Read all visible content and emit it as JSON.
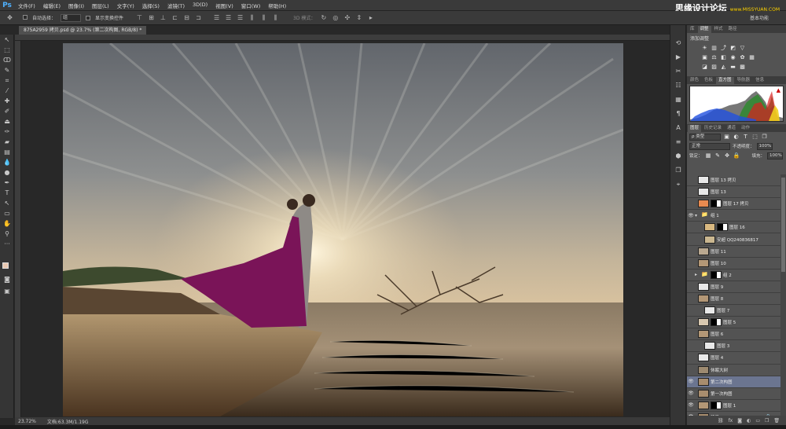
{
  "app": {
    "logo": "Ps"
  },
  "menu": [
    "文件(F)",
    "编辑(E)",
    "图像(I)",
    "图层(L)",
    "文字(Y)",
    "选择(S)",
    "滤镜(T)",
    "3D(D)",
    "视图(V)",
    "窗口(W)",
    "帮助(H)"
  ],
  "watermark": {
    "main": "思缘设计论坛",
    "sub": "www.MISSYUAN.COM"
  },
  "options": {
    "auto_select_label": "自动选择：",
    "auto_select_value": "组",
    "show_transform_label": "显示变换控件",
    "mode_3d_label": "3D 模式："
  },
  "workspace_label": "基本功能",
  "document_tab": "875A2959 拷贝.psd @ 23.7% (第二次构图, RGB/8) *",
  "status": {
    "zoom": "23.72%",
    "doc_size": "文档:63.3M/1.19G"
  },
  "panels": {
    "top_tabs": [
      "库",
      "调整",
      "样式",
      "路径"
    ],
    "adjust_title": "添加调整",
    "mid_tabs": [
      "颜色",
      "色板",
      "直方图",
      "导航器",
      "信息"
    ],
    "layer_tabs": [
      "图层",
      "历史记录",
      "通道",
      "动作"
    ],
    "kind_filter": "ρ 类型",
    "blend_mode": "正常",
    "opacity_label": "不透明度：",
    "opacity_value": "100%",
    "lock_label": "锁定：",
    "fill_label": "填充：",
    "fill_value": "100%"
  },
  "layers": [
    {
      "name": "图层 13 拷贝",
      "visible": false,
      "thumb": "#e8e8e8",
      "mask": false,
      "indent": 0
    },
    {
      "name": "图层 13",
      "visible": false,
      "thumb": "#e8e8e8",
      "mask": false,
      "indent": 0
    },
    {
      "name": "图层 17 拷贝",
      "visible": false,
      "thumb": "#e88a50",
      "mask": true,
      "indent": 0
    },
    {
      "name": "组 1",
      "visible": true,
      "thumb": "folder",
      "mask": false,
      "indent": 0,
      "group": true
    },
    {
      "name": "图层 16",
      "visible": false,
      "thumb": "#d8b880",
      "mask": true,
      "indent": 1
    },
    {
      "name": "安超 QQ240836817",
      "visible": false,
      "thumb": "#cab790",
      "mask": false,
      "indent": 1
    },
    {
      "name": "图层 11",
      "visible": false,
      "thumb": "#b9a890",
      "mask": false,
      "indent": 0
    },
    {
      "name": "图层 10",
      "visible": false,
      "thumb": "#b39776",
      "mask": false,
      "indent": 0
    },
    {
      "name": "组 2",
      "visible": false,
      "thumb": "folder",
      "mask": true,
      "indent": 0,
      "group": true
    },
    {
      "name": "图层 9",
      "visible": false,
      "thumb": "#e8e8e8",
      "mask": false,
      "indent": 0
    },
    {
      "name": "图层 8",
      "visible": false,
      "thumb": "#b39776",
      "mask": false,
      "indent": 0
    },
    {
      "name": "图层 7",
      "visible": false,
      "thumb": "#e8e8e8",
      "mask": false,
      "indent": 1
    },
    {
      "name": "图层 5",
      "visible": false,
      "thumb": "#d8c8b0",
      "mask": true,
      "indent": 0
    },
    {
      "name": "图层 6",
      "visible": false,
      "thumb": "#b39776",
      "mask": false,
      "indent": 0
    },
    {
      "name": "图层 3",
      "visible": false,
      "thumb": "#e8e8e8",
      "mask": false,
      "indent": 1
    },
    {
      "name": "图层 4",
      "visible": false,
      "thumb": "#e8e8e8",
      "mask": false,
      "indent": 0
    },
    {
      "name": "休眠大树",
      "visible": false,
      "thumb": "#9d8a70",
      "mask": false,
      "indent": 0
    },
    {
      "name": "第二次构图",
      "visible": true,
      "thumb": "#a88d6e",
      "mask": false,
      "indent": 0,
      "selected": true
    },
    {
      "name": "第一次构图",
      "visible": true,
      "thumb": "#a88d6e",
      "mask": false,
      "indent": 0
    },
    {
      "name": "图层 1",
      "visible": true,
      "thumb": "#b39776",
      "mask": true,
      "indent": 0
    },
    {
      "name": "背景",
      "visible": true,
      "thumb": "#a88d6e",
      "mask": false,
      "indent": 0,
      "locked": true
    }
  ],
  "colors": {
    "accent": "#4fb1ff",
    "selected_layer": "#6b7590",
    "dress": "#7a1458"
  }
}
